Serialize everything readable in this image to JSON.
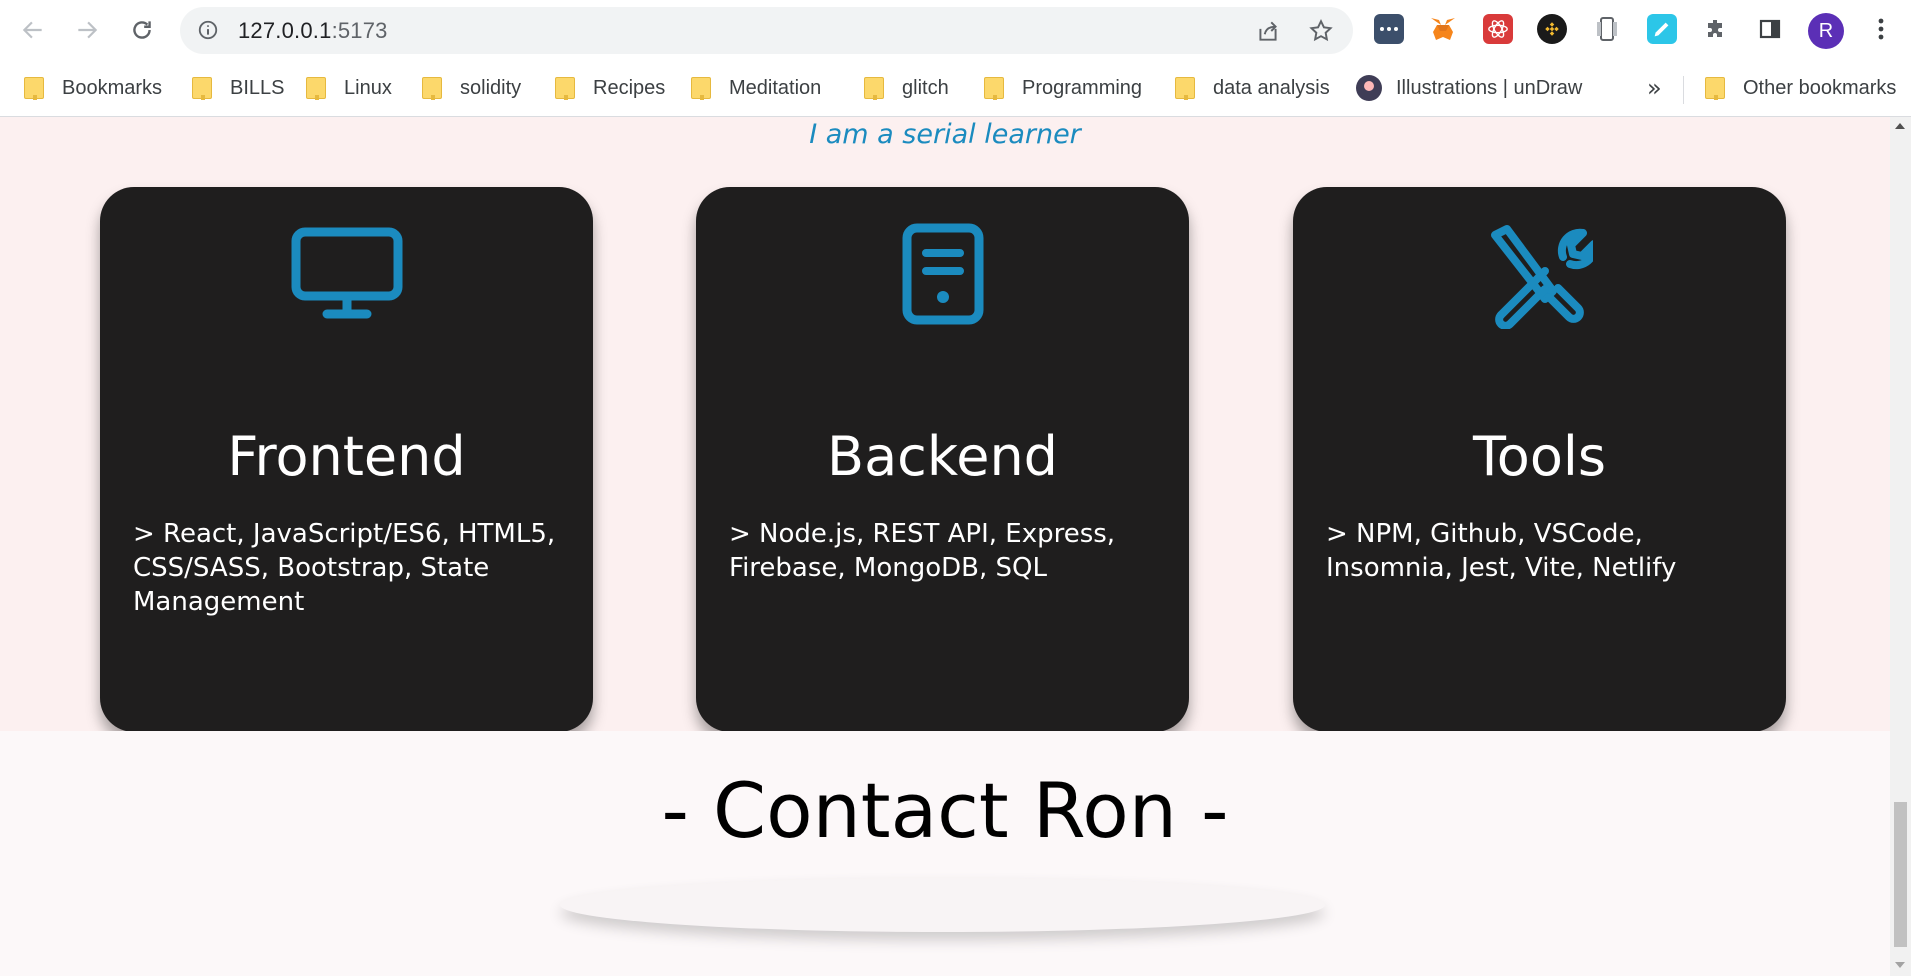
{
  "browser": {
    "url_host": "127.0.0.1",
    "url_port": ":5173",
    "avatar_letter": "R",
    "bookmarks": [
      {
        "label": "Bookmarks"
      },
      {
        "label": "BILLS"
      },
      {
        "label": "Linux"
      },
      {
        "label": "solidity"
      },
      {
        "label": "Recipes"
      },
      {
        "label": "Meditation"
      },
      {
        "label": "glitch"
      },
      {
        "label": "Programming"
      },
      {
        "label": "data analysis"
      },
      {
        "label": "Illustrations | unDraw"
      }
    ],
    "overflow_chevron": "»",
    "other_bookmarks": "Other bookmarks"
  },
  "page": {
    "subtitle": "I am a serial learner",
    "cards": [
      {
        "title": "Frontend",
        "description": "> React, JavaScript/ES6, HTML5, CSS/SASS, Bootstrap, State Management",
        "icon": "monitor-icon"
      },
      {
        "title": "Backend",
        "description": "> Node.js, REST API, Express, Firebase, MongoDB, SQL",
        "icon": "server-icon"
      },
      {
        "title": "Tools",
        "description": "> NPM, Github, VSCode, Insomnia, Jest, Vite, Netlify",
        "icon": "tools-icon"
      }
    ],
    "contact_title": "- Contact Ron -",
    "accent_color": "#1b8bbf",
    "card_color": "#1f1e1e"
  }
}
